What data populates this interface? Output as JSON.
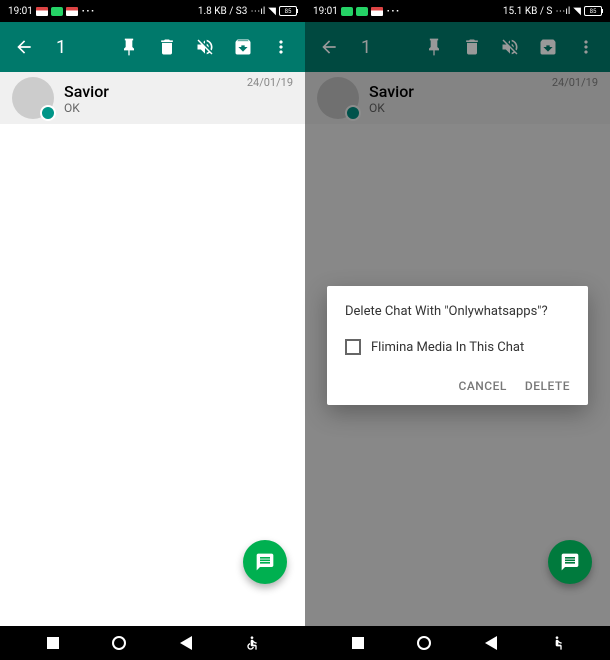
{
  "status": {
    "time": "19:01",
    "data_left": "1.8 KB / S3",
    "data_right": "15.1 KB / S",
    "battery": "85"
  },
  "toolbar": {
    "selected_count": "1"
  },
  "chat": {
    "name": "Savior",
    "message": "OK",
    "date": "24/01/19"
  },
  "dialog": {
    "title": "Delete Chat With \"Onlywhatsapps\"?",
    "checkbox_label": "Flimina Media In This Chat",
    "cancel": "CANCEL",
    "delete": "DELETE"
  }
}
